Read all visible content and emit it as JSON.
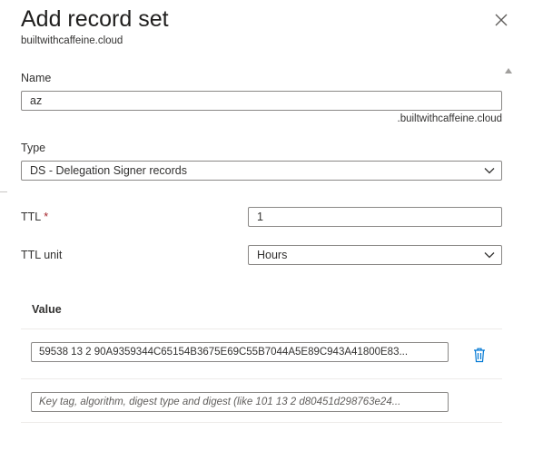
{
  "panel": {
    "title": "Add record set",
    "subtitle": "builtwithcaffeine.cloud",
    "close_icon": "close-icon"
  },
  "form": {
    "name_label": "Name",
    "name_value": "az",
    "name_suffix": ".builtwithcaffeine.cloud",
    "type_label": "Type",
    "type_value": "DS - Delegation Signer records",
    "ttl_label": "TTL",
    "ttl_required_mark": "*",
    "ttl_value": "1",
    "ttl_unit_label": "TTL unit",
    "ttl_unit_value": "Hours"
  },
  "values_table": {
    "header": "Value",
    "rows": [
      {
        "value": "59538 13 2 90A9359344C65154B3675E69C55B7044A5E89C943A41800E83..."
      }
    ],
    "new_row_placeholder": "Key tag, algorithm, digest type and digest (like 101 13 2 d80451d298763e24...",
    "delete_icon": "trash-icon"
  },
  "colors": {
    "accent": "#0078d4",
    "border": "#8a8886",
    "required": "#a4262c"
  }
}
